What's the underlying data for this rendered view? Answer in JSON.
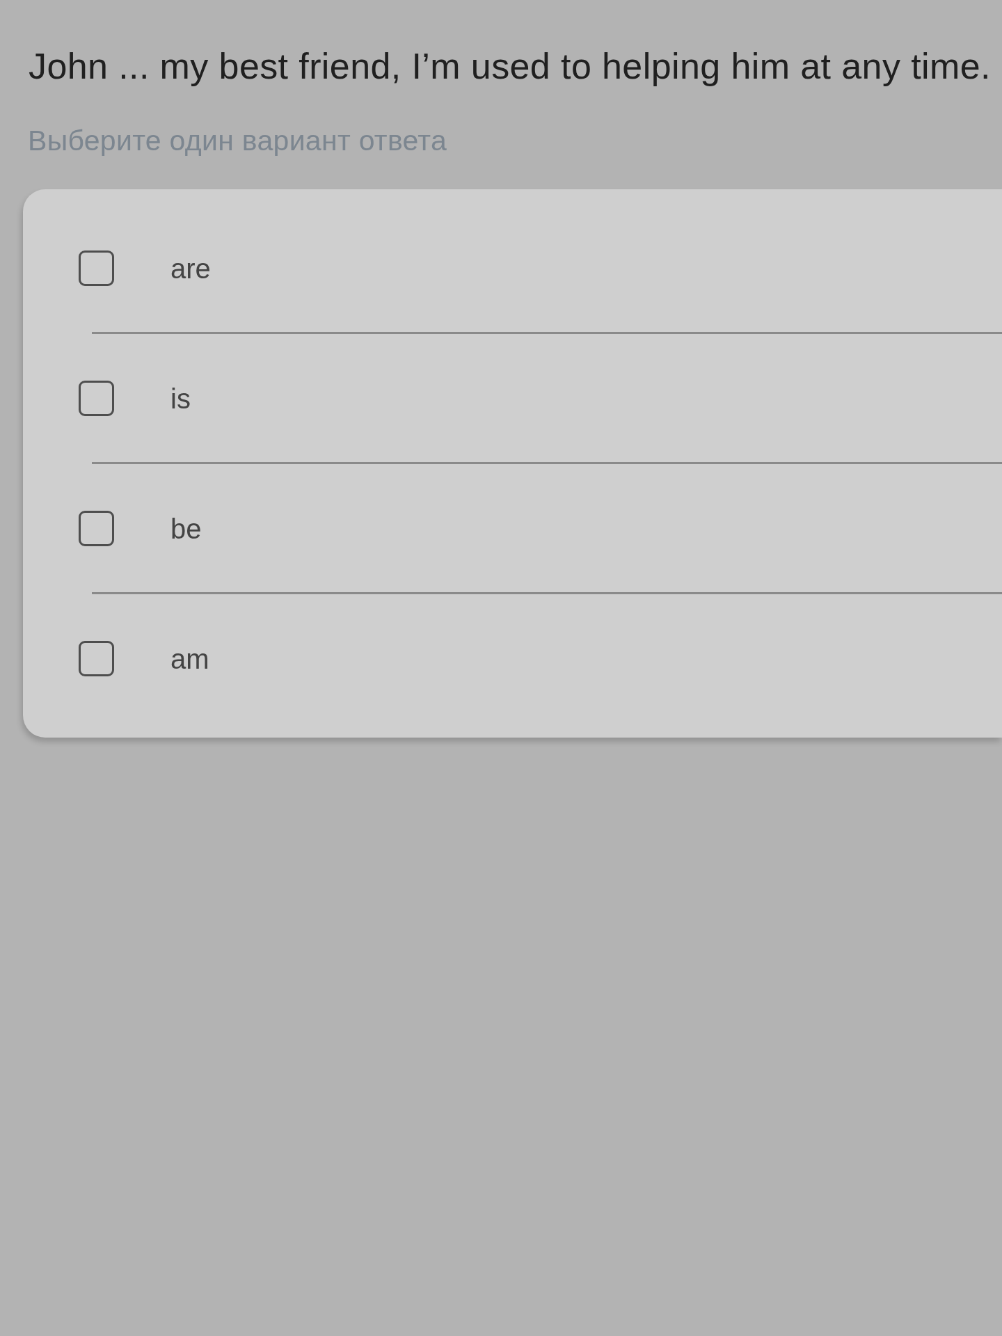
{
  "question": {
    "text": "John ... my best friend, I’m used to helping him at any time."
  },
  "hint": "Выберите один вариант ответа",
  "options": [
    {
      "label": "are",
      "checked": false
    },
    {
      "label": "is",
      "checked": false
    },
    {
      "label": "be",
      "checked": false
    },
    {
      "label": "am",
      "checked": false
    }
  ]
}
